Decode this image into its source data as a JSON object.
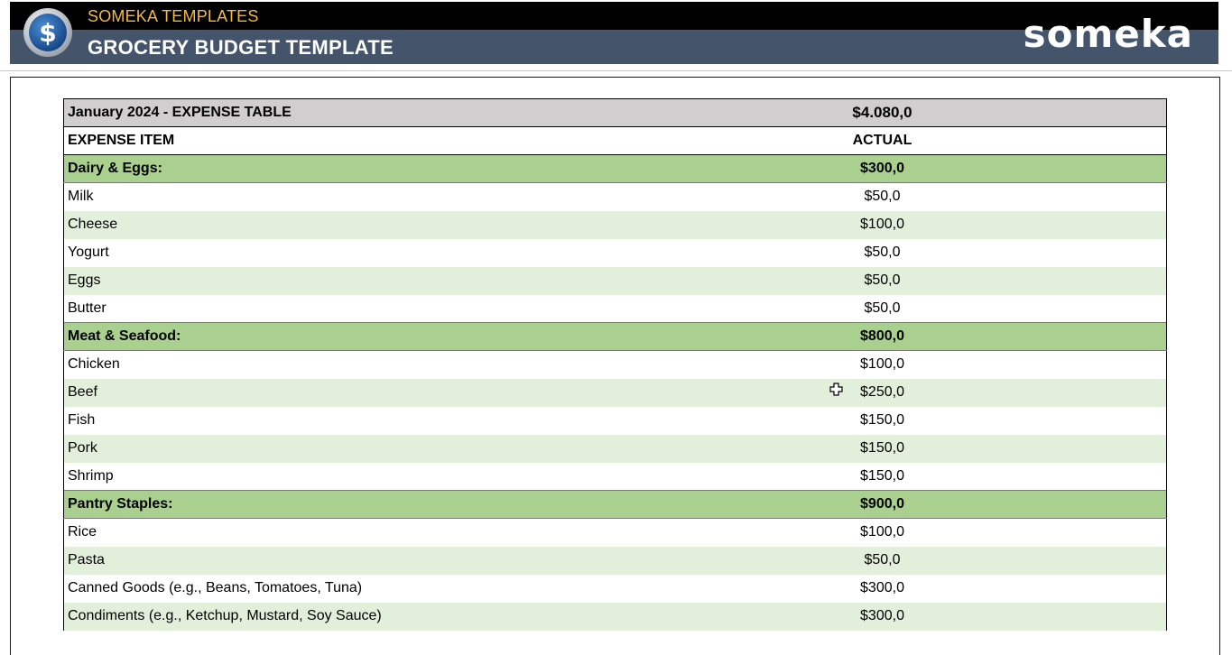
{
  "header": {
    "brand": "SOMEKA TEMPLATES",
    "title": "GROCERY BUDGET TEMPLATE",
    "logo": "someka",
    "coin_icon": "dollar-coin-icon",
    "colors": {
      "banner": "#44546a",
      "brand": "#f4b942",
      "category": "#a9d08e",
      "row_alt": "#e2efda"
    }
  },
  "table": {
    "title": "January 2024 - EXPENSE TABLE",
    "total": "$4.080,0",
    "col_item": "EXPENSE ITEM",
    "col_actual": "ACTUAL",
    "categories": [
      {
        "name": "Dairy & Eggs:",
        "total": "$300,0",
        "items": [
          {
            "name": "Milk",
            "amount": "$50,0"
          },
          {
            "name": "Cheese",
            "amount": "$100,0"
          },
          {
            "name": "Yogurt",
            "amount": "$50,0"
          },
          {
            "name": "Eggs",
            "amount": "$50,0"
          },
          {
            "name": "Butter",
            "amount": "$50,0"
          }
        ]
      },
      {
        "name": "Meat & Seafood:",
        "total": "$800,0",
        "items": [
          {
            "name": "Chicken",
            "amount": "$100,0"
          },
          {
            "name": "Beef",
            "amount": "$250,0"
          },
          {
            "name": "Fish",
            "amount": "$150,0"
          },
          {
            "name": "Pork",
            "amount": "$150,0"
          },
          {
            "name": "Shrimp",
            "amount": "$150,0"
          }
        ]
      },
      {
        "name": "Pantry Staples:",
        "total": "$900,0",
        "items": [
          {
            "name": "Rice",
            "amount": "$100,0"
          },
          {
            "name": "Pasta",
            "amount": "$50,0"
          },
          {
            "name": "Canned Goods (e.g., Beans, Tomatoes, Tuna)",
            "amount": "$300,0"
          },
          {
            "name": "Condiments (e.g., Ketchup, Mustard, Soy Sauce)",
            "amount": "$300,0"
          }
        ]
      }
    ]
  }
}
